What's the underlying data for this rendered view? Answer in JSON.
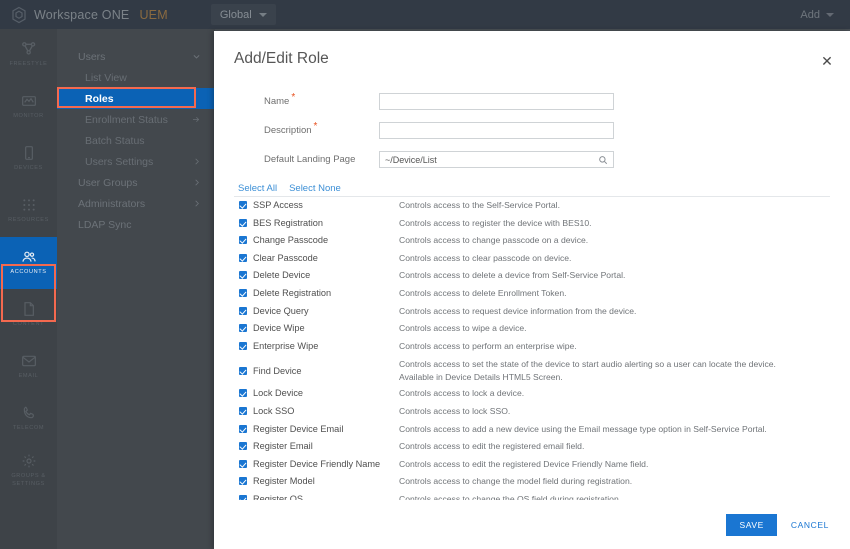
{
  "topbar": {
    "brand": "Workspace ONE",
    "brand_suffix": "UEM",
    "org_group": "Global",
    "add_label": "Add"
  },
  "rail": {
    "items": [
      {
        "label": "FREESTYLE",
        "icon": "freestyle-icon",
        "active": false
      },
      {
        "label": "MONITOR",
        "icon": "monitor-icon",
        "active": false
      },
      {
        "label": "DEVICES",
        "icon": "device-icon",
        "active": false
      },
      {
        "label": "RESOURCES",
        "icon": "resources-icon",
        "active": false
      },
      {
        "label": "ACCOUNTS",
        "icon": "accounts-icon",
        "active": true
      },
      {
        "label": "CONTENT",
        "icon": "content-icon",
        "active": false
      },
      {
        "label": "EMAIL",
        "icon": "email-icon",
        "active": false
      },
      {
        "label": "TELECOM",
        "icon": "telecom-icon",
        "active": false
      },
      {
        "label": "GROUPS & SETTINGS",
        "icon": "gear-icon",
        "active": false
      }
    ]
  },
  "subnav": {
    "items": [
      {
        "label": "Users",
        "type": "group",
        "marker": "chevron-down"
      },
      {
        "label": "List View",
        "type": "sub",
        "marker": ""
      },
      {
        "label": "Roles",
        "type": "sub",
        "marker": "",
        "selected": true
      },
      {
        "label": "Enrollment Status",
        "type": "sub",
        "marker": "arrow-right"
      },
      {
        "label": "Batch Status",
        "type": "sub",
        "marker": ""
      },
      {
        "label": "Users Settings",
        "type": "sub",
        "marker": "chevron-right"
      },
      {
        "label": "User Groups",
        "type": "group",
        "marker": "chevron-right"
      },
      {
        "label": "Administrators",
        "type": "group",
        "marker": "chevron-right"
      },
      {
        "label": "LDAP Sync",
        "type": "group",
        "marker": ""
      }
    ]
  },
  "modal": {
    "title": "Add/Edit Role",
    "close_label": "✕",
    "fields": [
      {
        "label": "Name",
        "required": true,
        "value": "",
        "placeholder": ""
      },
      {
        "label": "Description",
        "required": true,
        "value": "",
        "placeholder": ""
      },
      {
        "label": "Default Landing Page",
        "required": false,
        "value": "~/Device/List",
        "placeholder": "",
        "icon": "search-icon"
      }
    ],
    "select_all": "Select All",
    "select_none": "Select None",
    "permissions": [
      {
        "name": "SSP Access",
        "desc": "Controls access to the Self-Service Portal.",
        "checked": true
      },
      {
        "name": "BES Registration",
        "desc": "Controls access to register the device with BES10.",
        "checked": true
      },
      {
        "name": "Change Passcode",
        "desc": "Controls access to change passcode on a device.",
        "checked": true
      },
      {
        "name": "Clear Passcode",
        "desc": "Controls access to clear passcode on device.",
        "checked": true
      },
      {
        "name": "Delete Device",
        "desc": "Controls access to delete a device from Self-Service Portal.",
        "checked": true
      },
      {
        "name": "Delete Registration",
        "desc": "Controls access to delete Enrollment Token.",
        "checked": true
      },
      {
        "name": "Device Query",
        "desc": "Controls access to request device information from the device.",
        "checked": true
      },
      {
        "name": "Device Wipe",
        "desc": "Controls access to wipe a device.",
        "checked": true
      },
      {
        "name": "Enterprise Wipe",
        "desc": "Controls access to perform an enterprise wipe.",
        "checked": true
      },
      {
        "name": "Find Device",
        "desc": "Controls access to set the state of the device to start audio alerting so a user can locate the device. Available in Device Details HTML5 Screen.",
        "checked": true,
        "tall": true
      },
      {
        "name": "Lock Device",
        "desc": "Controls access to lock a device.",
        "checked": true
      },
      {
        "name": "Lock SSO",
        "desc": "Controls access to lock SSO.",
        "checked": true
      },
      {
        "name": "Register Device Email",
        "desc": "Controls access to add a new device using the Email message type option in Self-Service Portal.",
        "checked": true
      },
      {
        "name": "Register Email",
        "desc": "Controls access to edit the registered email field.",
        "checked": true
      },
      {
        "name": "Register Device Friendly Name",
        "desc": "Controls access to edit the registered Device Friendly Name field.",
        "checked": true
      },
      {
        "name": "Register Model",
        "desc": "Controls access to change the model field during registration.",
        "checked": true
      },
      {
        "name": "Register OS",
        "desc": "Controls access to change the OS field during registration.",
        "checked": true
      }
    ],
    "save_label": "SAVE",
    "cancel_label": "CANCEL"
  },
  "colors": {
    "accent_blue": "#1a76d2",
    "nav_selected": "#0b62b5",
    "highlight_outline": "#f4694f",
    "topbar_bg": "#323a45",
    "rail_bg": "#3e4348",
    "subnav_bg": "#43484d",
    "required_star": "#e8501e",
    "link_blue": "#3c8fd6"
  }
}
